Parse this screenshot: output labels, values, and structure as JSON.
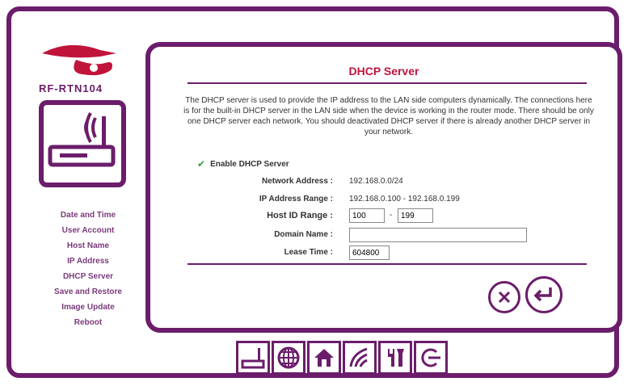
{
  "brand": {
    "model": "RF-RTN104"
  },
  "sidebar": {
    "items": [
      {
        "label": "Date and Time"
      },
      {
        "label": "User Account"
      },
      {
        "label": "Host Name"
      },
      {
        "label": "IP Address"
      },
      {
        "label": "DHCP Server"
      },
      {
        "label": "Save and Restore"
      },
      {
        "label": "Image Update"
      },
      {
        "label": "Reboot"
      }
    ]
  },
  "panel": {
    "title": "DHCP Server",
    "description": "The DHCP server is used to provide the IP address to the LAN side computers dynamically. The connections here is for the built-in DHCP server in the LAN side when the device is working in the router mode. There should be only one DHCP server each network. You should deactivated DHCP server if there is already another DHCP server in your network.",
    "enable_label": "Enable DHCP Server",
    "enable_checked": true,
    "fields": {
      "network_address": {
        "label": "Network Address :",
        "value": "192.168.0.0/24"
      },
      "ip_range": {
        "label": "IP Address Range :",
        "value": "192.168.0.100 - 192.168.0.199"
      },
      "host_id_range": {
        "label": "Host ID Range :",
        "from": "100",
        "separator": "-",
        "to": "199"
      },
      "domain_name": {
        "label": "Domain Name :",
        "value": ""
      },
      "lease_time": {
        "label": "Lease Time :",
        "value": "604800"
      }
    }
  },
  "actions": {
    "cancel": "cancel-icon",
    "apply": "return-icon"
  },
  "toolbar": [
    "device-icon",
    "globe-icon",
    "home-icon",
    "wireless-icon",
    "tools-icon",
    "logout-icon"
  ],
  "colors": {
    "frame": "#6b1d6b",
    "title": "#c0143c",
    "logo": "#c0143c",
    "check": "#3a9a3a"
  }
}
